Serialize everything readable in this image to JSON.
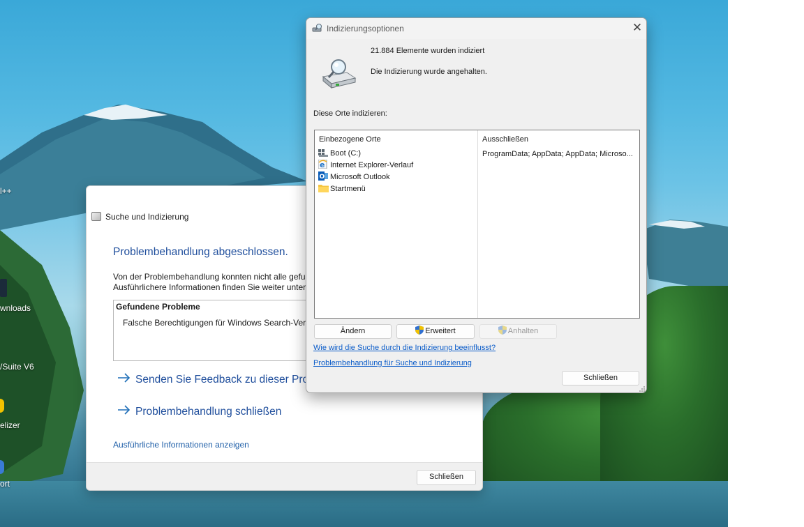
{
  "desktop": {
    "labels": [
      "l++",
      "wnloads",
      "/Suite V6",
      "elizer",
      "ort"
    ]
  },
  "troubleshooter": {
    "window_title": "Suche und Indizierung",
    "heading": "Problembehandlung abgeschlossen.",
    "paragraph_line1": "Von der Problembehandlung konnten nicht alle gefu",
    "paragraph_line2": "Ausführlichere Informationen finden Sie weiter unter",
    "problems_header": "Gefundene Probleme",
    "problem_item": "Falsche Berechtigungen für Windows Search-Verze",
    "feedback_link": "Senden Sie Feedback zu dieser Prob",
    "close_troubleshooter_link": "Problembehandlung schließen",
    "details_link": "Ausführliche Informationen anzeigen",
    "close_button": "Schließen"
  },
  "indexing": {
    "window_title": "Indizierungsoptionen",
    "items_indexed": "21.884 Elemente wurden indiziert",
    "status": "Die Indizierung wurde angehalten.",
    "section_label": "Diese Orte indizieren:",
    "col_included": "Einbezogene Orte",
    "col_exclude": "Ausschließen",
    "locations": [
      {
        "label": "Boot (C:)",
        "icon": "drive-icon"
      },
      {
        "label": "Internet Explorer-Verlauf",
        "icon": "ie-icon"
      },
      {
        "label": "Microsoft Outlook",
        "icon": "outlook-icon"
      },
      {
        "label": "Startmenü",
        "icon": "folder-icon"
      }
    ],
    "exclusions": "ProgramData; AppData; AppData; Microso...",
    "btn_modify": "Ändern",
    "btn_advanced": "Erweitert",
    "btn_pause": "Anhalten",
    "link_how": "Wie wird die Suche durch die Indizierung beeinflusst?",
    "link_troubleshoot": "Problembehandlung für Suche und Indizierung",
    "btn_close": "Schließen"
  },
  "colors": {
    "link_blue": "#1f4e9c",
    "hyperlink": "#0b5cc9",
    "dialog_bg": "#f0f0f0"
  }
}
